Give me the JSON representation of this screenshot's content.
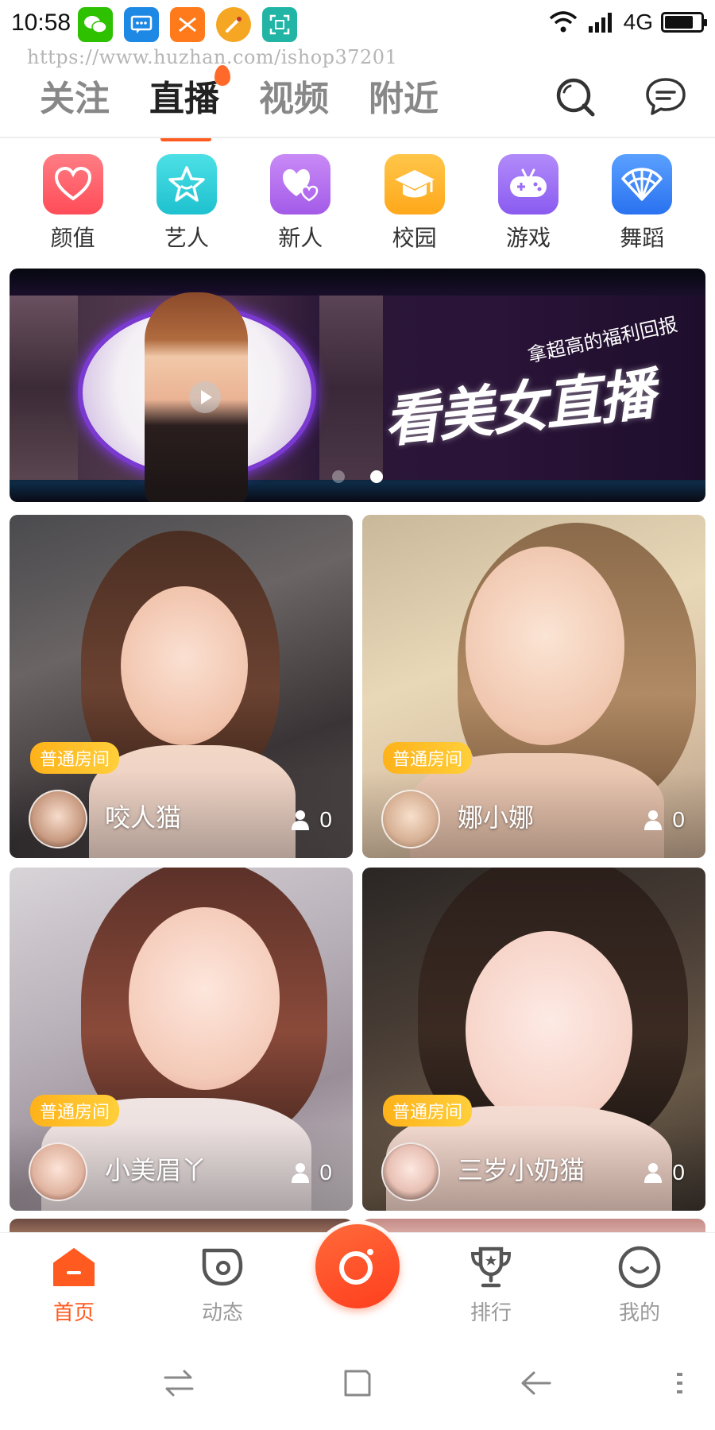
{
  "status_bar": {
    "time": "10:58",
    "network": "4G",
    "battery_level": 0.8,
    "apps": [
      {
        "icon": "wechat-icon",
        "color": "#2dc100"
      },
      {
        "icon": "message-icon",
        "color": "#1e88e5"
      },
      {
        "icon": "shuffle-icon",
        "color": "#ff7a1a"
      },
      {
        "icon": "brush-icon",
        "color": "#f5a623"
      },
      {
        "icon": "scan-icon",
        "color": "#22b5a6"
      }
    ]
  },
  "watermark": "https://www.huzhan.com/ishop37201",
  "top_tabs": [
    "关注",
    "直播",
    "视频",
    "附近"
  ],
  "active_tab": "直播",
  "accent_color": "#ff5a1f",
  "categories": [
    {
      "label": "颜值",
      "icon": "heart-icon",
      "color": "#ff5c66"
    },
    {
      "label": "艺人",
      "icon": "star-icon",
      "color": "#2fd0d8"
    },
    {
      "label": "新人",
      "icon": "hearts-icon",
      "color": "#b36cf0"
    },
    {
      "label": "校园",
      "icon": "graduation-cap-icon",
      "color": "#ffb020"
    },
    {
      "label": "游戏",
      "icon": "gamepad-icon",
      "color": "#9b6cf5"
    },
    {
      "label": "舞蹈",
      "icon": "fan-icon",
      "color": "#3a86ff"
    }
  ],
  "banner": {
    "subtitle": "拿超高的福利回报",
    "title": "看美女直播",
    "dots": 2,
    "active_dot": 2
  },
  "rooms": [
    {
      "badge": "普通房间",
      "name": "咬人猫",
      "viewers": "0"
    },
    {
      "badge": "普通房间",
      "name": "娜小娜",
      "viewers": "0"
    },
    {
      "badge": "普通房间",
      "name": "小美眉丫",
      "viewers": "0"
    },
    {
      "badge": "普通房间",
      "name": "三岁小奶猫",
      "viewers": "0"
    }
  ],
  "bottom_nav": {
    "home": "首页",
    "feed": "动态",
    "ranking": "排行",
    "mine": "我的"
  }
}
